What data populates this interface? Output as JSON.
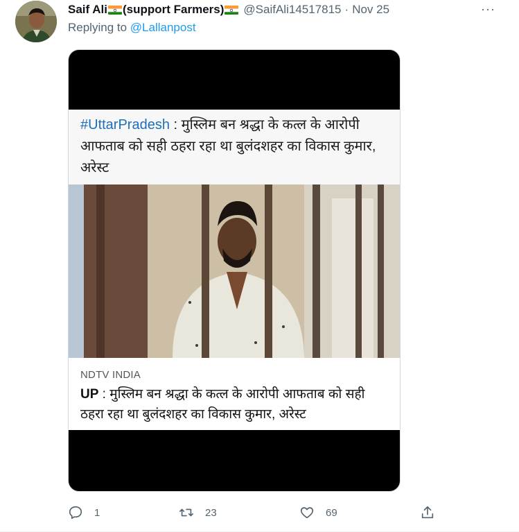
{
  "tweet": {
    "display_name": "Saif Ali",
    "display_name_suffix": "(support Farmers)",
    "handle": "@SaifAli14517815",
    "separator": "·",
    "date": "Nov 25",
    "more_label": "···",
    "replying_prefix": "Replying to",
    "replying_to": "@Lallanpost"
  },
  "card": {
    "hashtag": "#UttarPradesh",
    "headline_top": " : मुस्लिम बन श्रद्धा के कत्ल के आरोपी आफताब को सही ठहरा रहा था बुलंदशहर का विकास कुमार, अरेस्ट",
    "source": "NDTV INDIA",
    "headline_bottom_prefix": "UP",
    "headline_bottom": " : मुस्लिम बन श्रद्धा के कत्ल के आरोपी आफताब को सही ठहरा रहा था बुलंदशहर का विकास कुमार, अरेस्ट"
  },
  "actions": {
    "reply_count": "1",
    "retweet_count": "23",
    "like_count": "69",
    "icons": [
      "reply-icon",
      "retweet-icon",
      "like-icon",
      "share-icon"
    ]
  },
  "colors": {
    "link": "#1d9bf0",
    "muted": "#536471",
    "text": "#0f1419"
  }
}
